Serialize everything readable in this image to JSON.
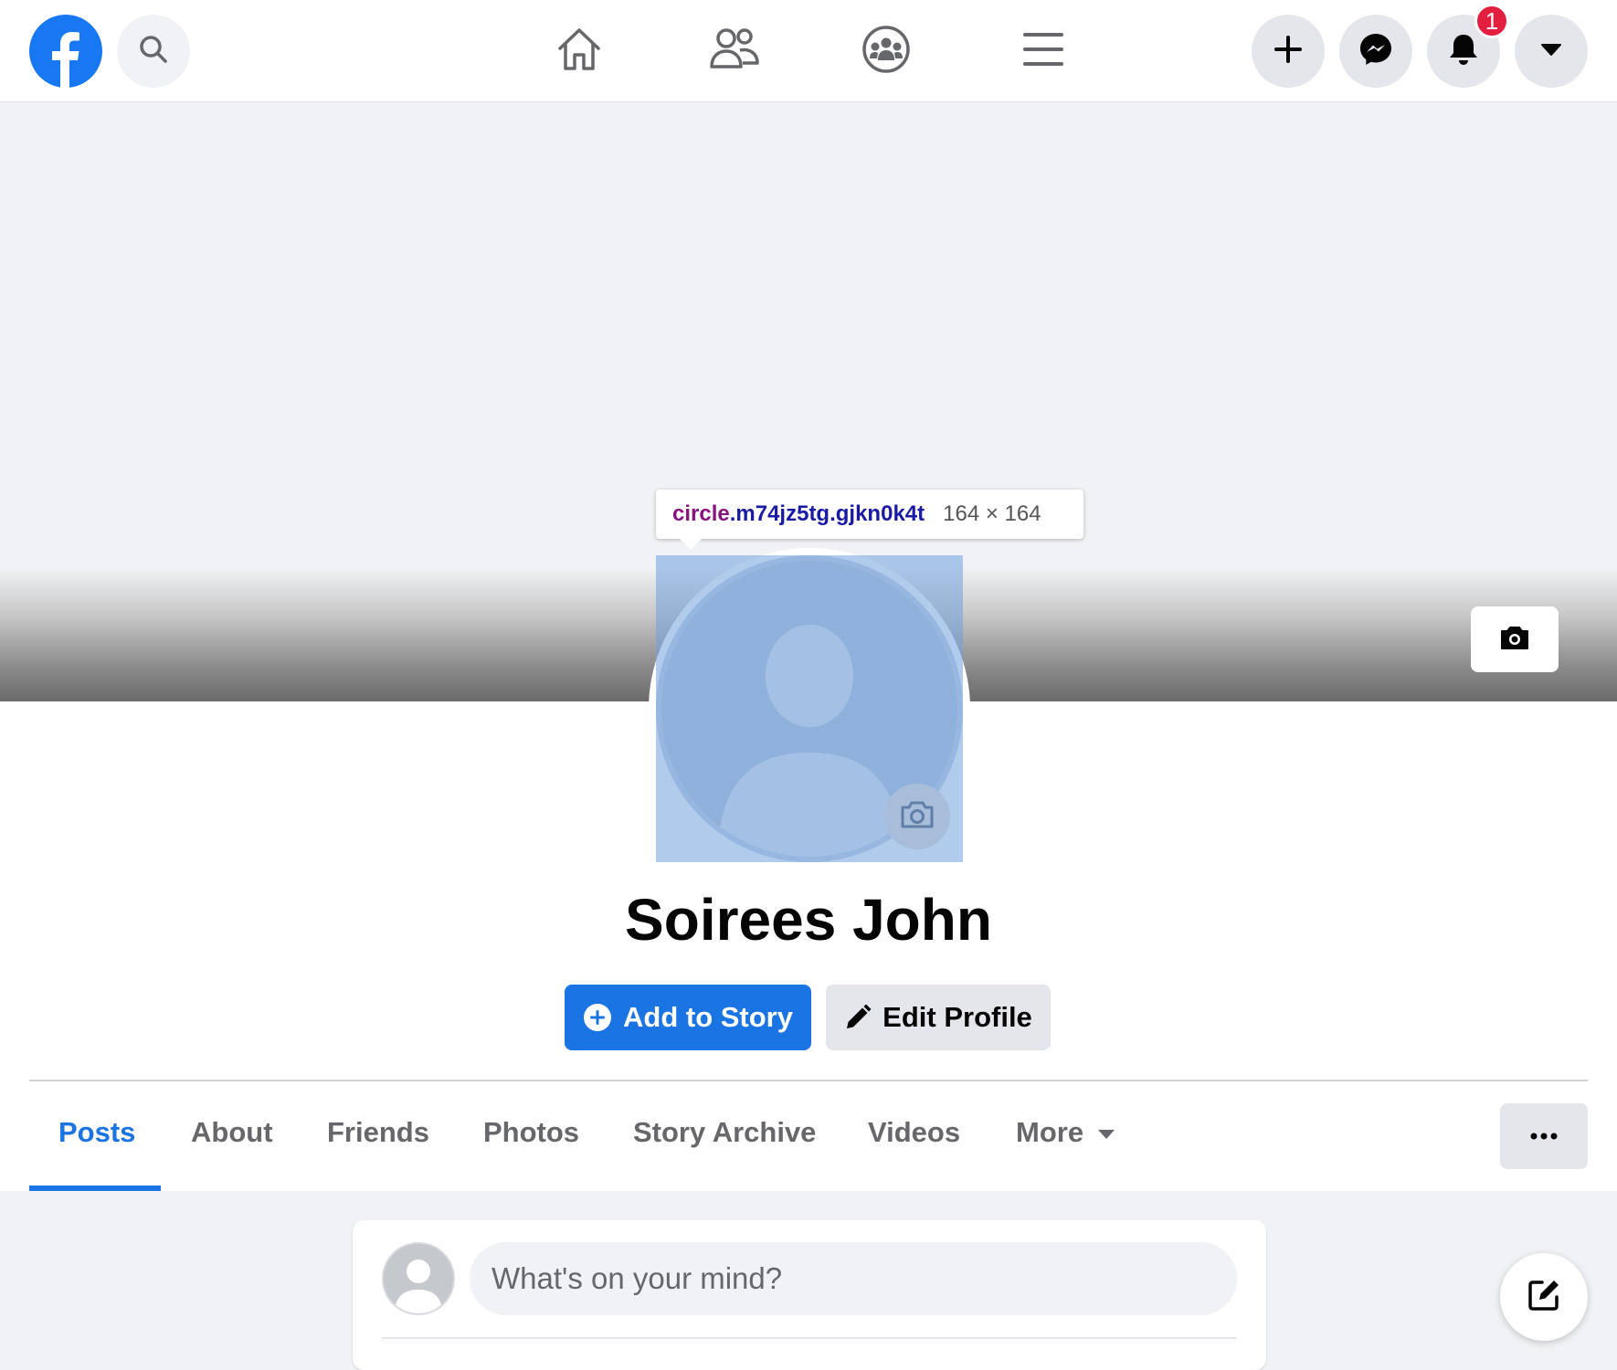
{
  "nav": {
    "notification_count": "1",
    "icons": [
      "facebook-logo",
      "search-icon",
      "home-icon",
      "friends-icon",
      "groups-icon",
      "menu-icon",
      "plus-icon",
      "messenger-icon",
      "bell-icon",
      "caret-down-icon"
    ]
  },
  "inspector": {
    "tag": "circle",
    "classes": ".m74jz5tg.gjkn0k4t",
    "size": "164 × 164"
  },
  "profile": {
    "name": "Soirees John",
    "add_story_label": "Add to Story",
    "edit_profile_label": "Edit Profile"
  },
  "tabs": [
    {
      "label": "Posts",
      "active": true
    },
    {
      "label": "About"
    },
    {
      "label": "Friends"
    },
    {
      "label": "Photos"
    },
    {
      "label": "Story Archive"
    },
    {
      "label": "Videos"
    },
    {
      "label": "More"
    }
  ],
  "composer": {
    "placeholder": "What's on your mind?"
  },
  "colors": {
    "brand": "#1b74e4",
    "badge": "#e41e3f",
    "highlight": "#6fa0dc"
  }
}
